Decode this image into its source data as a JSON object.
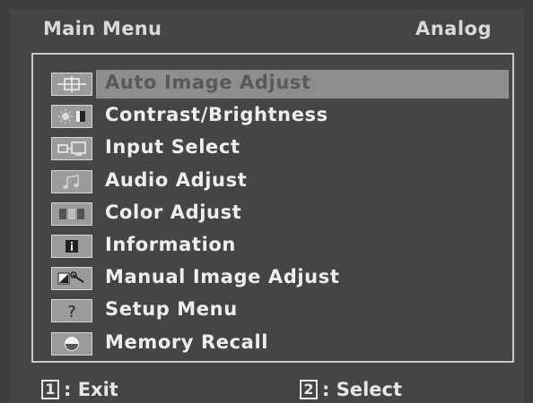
{
  "header": {
    "title": "Main Menu",
    "input_mode": "Analog"
  },
  "menu": {
    "items": [
      {
        "label": "Auto Image Adjust",
        "icon": "crosshair-move-icon",
        "selected": true
      },
      {
        "label": "Contrast/Brightness",
        "icon": "sun-contrast-icon"
      },
      {
        "label": "Input Select",
        "icon": "input-source-icon"
      },
      {
        "label": "Audio Adjust",
        "icon": "music-note-icon"
      },
      {
        "label": "Color Adjust",
        "icon": "color-bars-icon"
      },
      {
        "label": "Information",
        "icon": "info-icon"
      },
      {
        "label": "Manual Image Adjust",
        "icon": "image-wrench-icon"
      },
      {
        "label": "Setup Menu",
        "icon": "question-icon"
      },
      {
        "label": "Memory Recall",
        "icon": "recall-icon"
      }
    ]
  },
  "footer": {
    "exit": {
      "key": "1",
      "label": ": Exit"
    },
    "select": {
      "key": "2",
      "label": ": Select"
    }
  },
  "colors": {
    "background": "#3d3d3d",
    "highlight": "#8e8e8e",
    "text": "#eeeeee",
    "icon_bg": "#9b9b9b"
  }
}
